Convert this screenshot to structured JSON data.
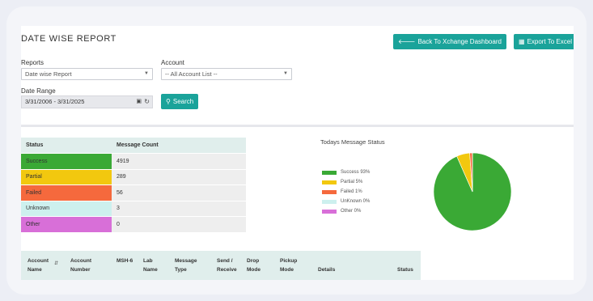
{
  "page": {
    "title": "DATE WISE REPORT",
    "back_button": "Back To Xchange Dashboard",
    "export_button": "Export To Excel"
  },
  "filters": {
    "reports_label": "Reports",
    "reports_value": "Date wise Report",
    "account_label": "Account",
    "account_value": "-- All Account List --",
    "date_range_label": "Date Range",
    "date_range_value": "3/31/2006 - 3/31/2025",
    "search_button": "Search"
  },
  "status_table": {
    "headers": [
      "Status",
      "Message Count"
    ],
    "rows": [
      {
        "status": "Success",
        "count": "4919",
        "color": "#3aa935"
      },
      {
        "status": "Partial",
        "count": "289",
        "color": "#f2c80f"
      },
      {
        "status": "Failed",
        "count": "56",
        "color": "#f5693d"
      },
      {
        "status": "Unknown",
        "count": "3",
        "color": "#cdf0ee"
      },
      {
        "status": "Other",
        "count": "0",
        "color": "#d86fd8"
      }
    ]
  },
  "chart": {
    "title": "Todays Message Status",
    "legend": [
      {
        "label": "Success 93%",
        "color": "#3aa935"
      },
      {
        "label": "Partial 5%",
        "color": "#f2c80f"
      },
      {
        "label": "Failed 1%",
        "color": "#f5693d"
      },
      {
        "label": "UnKnown 0%",
        "color": "#cdf0ee"
      },
      {
        "label": "Other 0%",
        "color": "#d86fd8"
      }
    ]
  },
  "chart_data": {
    "type": "pie",
    "categories": [
      "Success",
      "Partial",
      "Failed",
      "UnKnown",
      "Other"
    ],
    "values": [
      4919,
      289,
      56,
      3,
      0
    ],
    "colors": [
      "#3aa935",
      "#f2c80f",
      "#f5693d",
      "#cdf0ee",
      "#d86fd8"
    ],
    "title": "Todays Message Status"
  },
  "grid": {
    "columns": [
      "Account Name",
      "Account Number",
      "MSH-6",
      "Lab Name",
      "Message Type",
      "Send / Receive",
      "Drop Mode",
      "Pickup Mode",
      "Details",
      "Status"
    ]
  },
  "icons": {
    "back": "arrow-left-icon",
    "export": "file-excel-icon",
    "search": "search-icon",
    "calendar": "calendar-icon",
    "refresh": "refresh-icon",
    "sort": "sort-icon"
  }
}
